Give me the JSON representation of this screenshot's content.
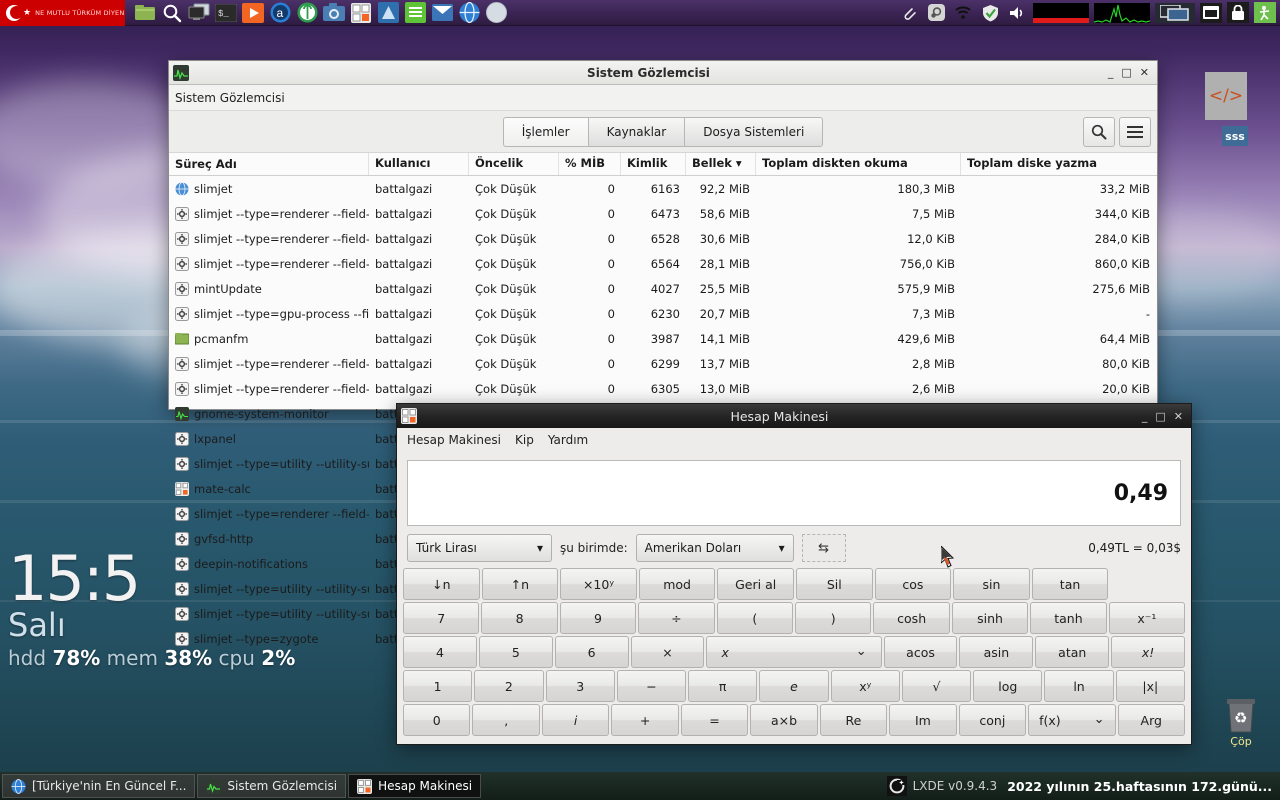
{
  "top_panel": {
    "menu_button": {
      "label": "NE MUTLU TÜRKÜM DİYENE",
      "icon": "turkish-flag-icon"
    },
    "launchers": [
      {
        "name": "file-manager-icon",
        "tip": "pcmanfm"
      },
      {
        "name": "search-icon",
        "tip": "search"
      },
      {
        "name": "display-icon",
        "tip": "displays"
      },
      {
        "name": "terminal-icon",
        "tip": "terminal"
      },
      {
        "name": "media-player-icon",
        "tip": "player"
      },
      {
        "name": "audacious-icon",
        "tip": "audacious"
      },
      {
        "name": "keepass-icon",
        "tip": "keepass"
      },
      {
        "name": "screenshot-icon",
        "tip": "screenshot"
      },
      {
        "name": "calculator-icon",
        "tip": "mate-calc"
      },
      {
        "name": "archive-icon",
        "tip": "archive"
      },
      {
        "name": "text-editor-icon",
        "tip": "text editor"
      },
      {
        "name": "mail-icon",
        "tip": "mail"
      },
      {
        "name": "browser-icon",
        "tip": "slimjet"
      },
      {
        "name": "globe-icon",
        "tip": "web"
      }
    ],
    "tray": [
      {
        "name": "clipboard-icon"
      },
      {
        "name": "steam-icon"
      },
      {
        "name": "wifi-icon"
      },
      {
        "name": "shield-ok-icon"
      },
      {
        "name": "volume-icon"
      },
      {
        "name": "network-monitor-graph"
      },
      {
        "name": "cpu-monitor-graph"
      },
      {
        "name": "window-list-icon"
      },
      {
        "name": "show-desktop-icon"
      },
      {
        "name": "lock-icon"
      },
      {
        "name": "logout-icon"
      }
    ]
  },
  "desktop": {
    "icons": [
      {
        "name": "code-shortcut",
        "glyph": "</>",
        "label": ""
      },
      {
        "name": "sss-shortcut",
        "glyph": "sss",
        "label": ""
      },
      {
        "name": "trash-shortcut",
        "glyph": "trash-icon",
        "label": "Çöp"
      }
    ],
    "conky": {
      "clock": "15:5",
      "day": "Salı",
      "stats_prefix": "hdd",
      "hdd_label": "hdd",
      "hdd_value": "78%",
      "mem_label": "mem",
      "mem_value": "38%",
      "cpu_label": "cpu",
      "cpu_value": "2%"
    }
  },
  "sysmon": {
    "title": "Sistem Gözlemcisi",
    "menubar": "Sistem Gözlemcisi",
    "window_buttons": {
      "minimize": "_",
      "maximize": "□",
      "close": "✕"
    },
    "tabs": [
      {
        "label": "İşlemler",
        "active": true
      },
      {
        "label": "Kaynaklar",
        "active": false
      },
      {
        "label": "Dosya Sistemleri",
        "active": false
      }
    ],
    "toolbar_buttons": [
      {
        "name": "search-icon",
        "glyph": "🔍"
      },
      {
        "name": "hamburger-menu-icon",
        "glyph": "≡"
      }
    ],
    "columns": [
      "Süreç Adı",
      "Kullanıcı",
      "Öncelik",
      "% MİB",
      "Kimlik",
      "Bellek ▾",
      "Toplam diskten okuma",
      "Toplam diske yazma"
    ],
    "rows": [
      {
        "icon": "globe-icon",
        "name": "slimjet",
        "user": "battalgazi",
        "priority": "Çok Düşük",
        "cpu": "0",
        "pid": "6163",
        "mem": "92,2 MiB",
        "read": "180,3 MiB",
        "write": "33,2 MiB"
      },
      {
        "icon": "gear-icon",
        "name": "slimjet --type=renderer --field-",
        "user": "battalgazi",
        "priority": "Çok Düşük",
        "cpu": "0",
        "pid": "6473",
        "mem": "58,6 MiB",
        "read": "7,5 MiB",
        "write": "344,0 KiB"
      },
      {
        "icon": "gear-icon",
        "name": "slimjet --type=renderer --field-",
        "user": "battalgazi",
        "priority": "Çok Düşük",
        "cpu": "0",
        "pid": "6528",
        "mem": "30,6 MiB",
        "read": "12,0 KiB",
        "write": "284,0 KiB"
      },
      {
        "icon": "gear-icon",
        "name": "slimjet --type=renderer --field-",
        "user": "battalgazi",
        "priority": "Çok Düşük",
        "cpu": "0",
        "pid": "6564",
        "mem": "28,1 MiB",
        "read": "756,0 KiB",
        "write": "860,0 KiB"
      },
      {
        "icon": "gear-icon",
        "name": "mintUpdate",
        "user": "battalgazi",
        "priority": "Çok Düşük",
        "cpu": "0",
        "pid": "4027",
        "mem": "25,5 MiB",
        "read": "575,9 MiB",
        "write": "275,6 MiB"
      },
      {
        "icon": "gear-icon",
        "name": "slimjet --type=gpu-process --fi",
        "user": "battalgazi",
        "priority": "Çok Düşük",
        "cpu": "0",
        "pid": "6230",
        "mem": "20,7 MiB",
        "read": "7,3 MiB",
        "write": "-"
      },
      {
        "icon": "folder-icon",
        "name": "pcmanfm",
        "user": "battalgazi",
        "priority": "Çok Düşük",
        "cpu": "0",
        "pid": "3987",
        "mem": "14,1 MiB",
        "read": "429,6 MiB",
        "write": "64,4 MiB"
      },
      {
        "icon": "gear-icon",
        "name": "slimjet --type=renderer --field-",
        "user": "battalgazi",
        "priority": "Çok Düşük",
        "cpu": "0",
        "pid": "6299",
        "mem": "13,7 MiB",
        "read": "2,8 MiB",
        "write": "80,0 KiB"
      },
      {
        "icon": "gear-icon",
        "name": "slimjet --type=renderer --field-",
        "user": "battalgazi",
        "priority": "Çok Düşük",
        "cpu": "0",
        "pid": "6305",
        "mem": "13,0 MiB",
        "read": "2,6 MiB",
        "write": "20,0 KiB"
      },
      {
        "icon": "monitor-icon",
        "name": "gnome-system-monitor",
        "user": "batt",
        "priority": "",
        "cpu": "",
        "pid": "",
        "mem": "",
        "read": "",
        "write": ""
      },
      {
        "icon": "gear-icon",
        "name": "lxpanel",
        "user": "batt",
        "priority": "",
        "cpu": "",
        "pid": "",
        "mem": "",
        "read": "",
        "write": ""
      },
      {
        "icon": "gear-icon",
        "name": "slimjet --type=utility --utility-su",
        "user": "batt",
        "priority": "",
        "cpu": "",
        "pid": "",
        "mem": "",
        "read": "",
        "write": ""
      },
      {
        "icon": "calc-icon",
        "name": "mate-calc",
        "user": "batt",
        "priority": "",
        "cpu": "",
        "pid": "",
        "mem": "",
        "read": "",
        "write": ""
      },
      {
        "icon": "gear-icon",
        "name": "slimjet --type=renderer --field-",
        "user": "batt",
        "priority": "",
        "cpu": "",
        "pid": "",
        "mem": "",
        "read": "",
        "write": ""
      },
      {
        "icon": "gear-icon",
        "name": "gvfsd-http",
        "user": "batt",
        "priority": "",
        "cpu": "",
        "pid": "",
        "mem": "",
        "read": "",
        "write": ""
      },
      {
        "icon": "gear-icon",
        "name": "deepin-notifications",
        "user": "batt",
        "priority": "",
        "cpu": "",
        "pid": "",
        "mem": "",
        "read": "",
        "write": ""
      },
      {
        "icon": "gear-icon",
        "name": "slimjet --type=utility --utility-su",
        "user": "batt",
        "priority": "",
        "cpu": "",
        "pid": "",
        "mem": "",
        "read": "",
        "write": ""
      },
      {
        "icon": "gear-icon",
        "name": "slimjet --type=utility --utility-su",
        "user": "batt",
        "priority": "",
        "cpu": "",
        "pid": "",
        "mem": "",
        "read": "",
        "write": ""
      },
      {
        "icon": "gear-icon",
        "name": "slimjet --type=zygote",
        "user": "batt",
        "priority": "",
        "cpu": "",
        "pid": "",
        "mem": "",
        "read": "",
        "write": ""
      }
    ]
  },
  "calc": {
    "title": "Hesap Makinesi",
    "window_buttons": {
      "minimize": "_",
      "maximize": "□",
      "close": "✕"
    },
    "menu": [
      "Hesap Makinesi",
      "Kip",
      "Yardım"
    ],
    "display_value": "0,49",
    "converter": {
      "from_unit": "Türk Lirası",
      "in_label": "şu birimde:",
      "to_unit": "Amerikan Doları",
      "swap_glyph": "⇆",
      "result": "0,49TL = 0,03$"
    },
    "keys": [
      [
        {
          "label": "↓n"
        },
        {
          "label": "↑n"
        },
        {
          "label": "×10ʸ"
        },
        {
          "label": "mod"
        },
        {
          "label": "Geri al"
        },
        {
          "label": "Sil"
        },
        {
          "label": "cos"
        },
        {
          "label": "sin"
        },
        {
          "label": "tan"
        },
        {
          "label": "",
          "blank": true
        }
      ],
      [
        {
          "label": "7"
        },
        {
          "label": "8"
        },
        {
          "label": "9"
        },
        {
          "label": "÷"
        },
        {
          "label": "("
        },
        {
          "label": ")"
        },
        {
          "label": "cosh"
        },
        {
          "label": "sinh"
        },
        {
          "label": "tanh"
        },
        {
          "label": "x⁻¹"
        }
      ],
      [
        {
          "label": "4"
        },
        {
          "label": "5"
        },
        {
          "label": "6"
        },
        {
          "label": "×"
        },
        {
          "label": "x",
          "wide": true,
          "chevron": true
        },
        {
          "label": "acos"
        },
        {
          "label": "asin"
        },
        {
          "label": "atan"
        },
        {
          "label": "x!"
        }
      ],
      [
        {
          "label": "1"
        },
        {
          "label": "2"
        },
        {
          "label": "3"
        },
        {
          "label": "−"
        },
        {
          "label": "π"
        },
        {
          "label": "e"
        },
        {
          "label": "xʸ"
        },
        {
          "label": "√"
        },
        {
          "label": "log"
        },
        {
          "label": "ln"
        },
        {
          "label": "|x|"
        }
      ],
      [
        {
          "label": "0"
        },
        {
          "label": ","
        },
        {
          "label": "i"
        },
        {
          "label": "+"
        },
        {
          "label": "="
        },
        {
          "label": "a×b"
        },
        {
          "label": "Re"
        },
        {
          "label": "Im"
        },
        {
          "label": "conj"
        },
        {
          "label": "f(x)",
          "chevron": true
        },
        {
          "label": "Arg"
        }
      ]
    ]
  },
  "taskbar": {
    "tasks": [
      {
        "label": "[Türkiye'nin En Güncel F...",
        "icon": "browser-icon",
        "active": false
      },
      {
        "label": "Sistem Gözlemcisi",
        "icon": "monitor-icon",
        "active": false
      },
      {
        "label": "Hesap Makinesi",
        "icon": "calc-icon",
        "active": true
      }
    ],
    "version_label": "LXDE v0.9.4.3",
    "clock": "2022 yılının 25.haftasının 172.günü..."
  },
  "colors": {
    "panel_bg": "#3c2555",
    "menu_red": "#cc0000",
    "accent_orange": "#d9541e",
    "window_chrome": "#232323",
    "taskbar_bg": "#1a2a20"
  }
}
